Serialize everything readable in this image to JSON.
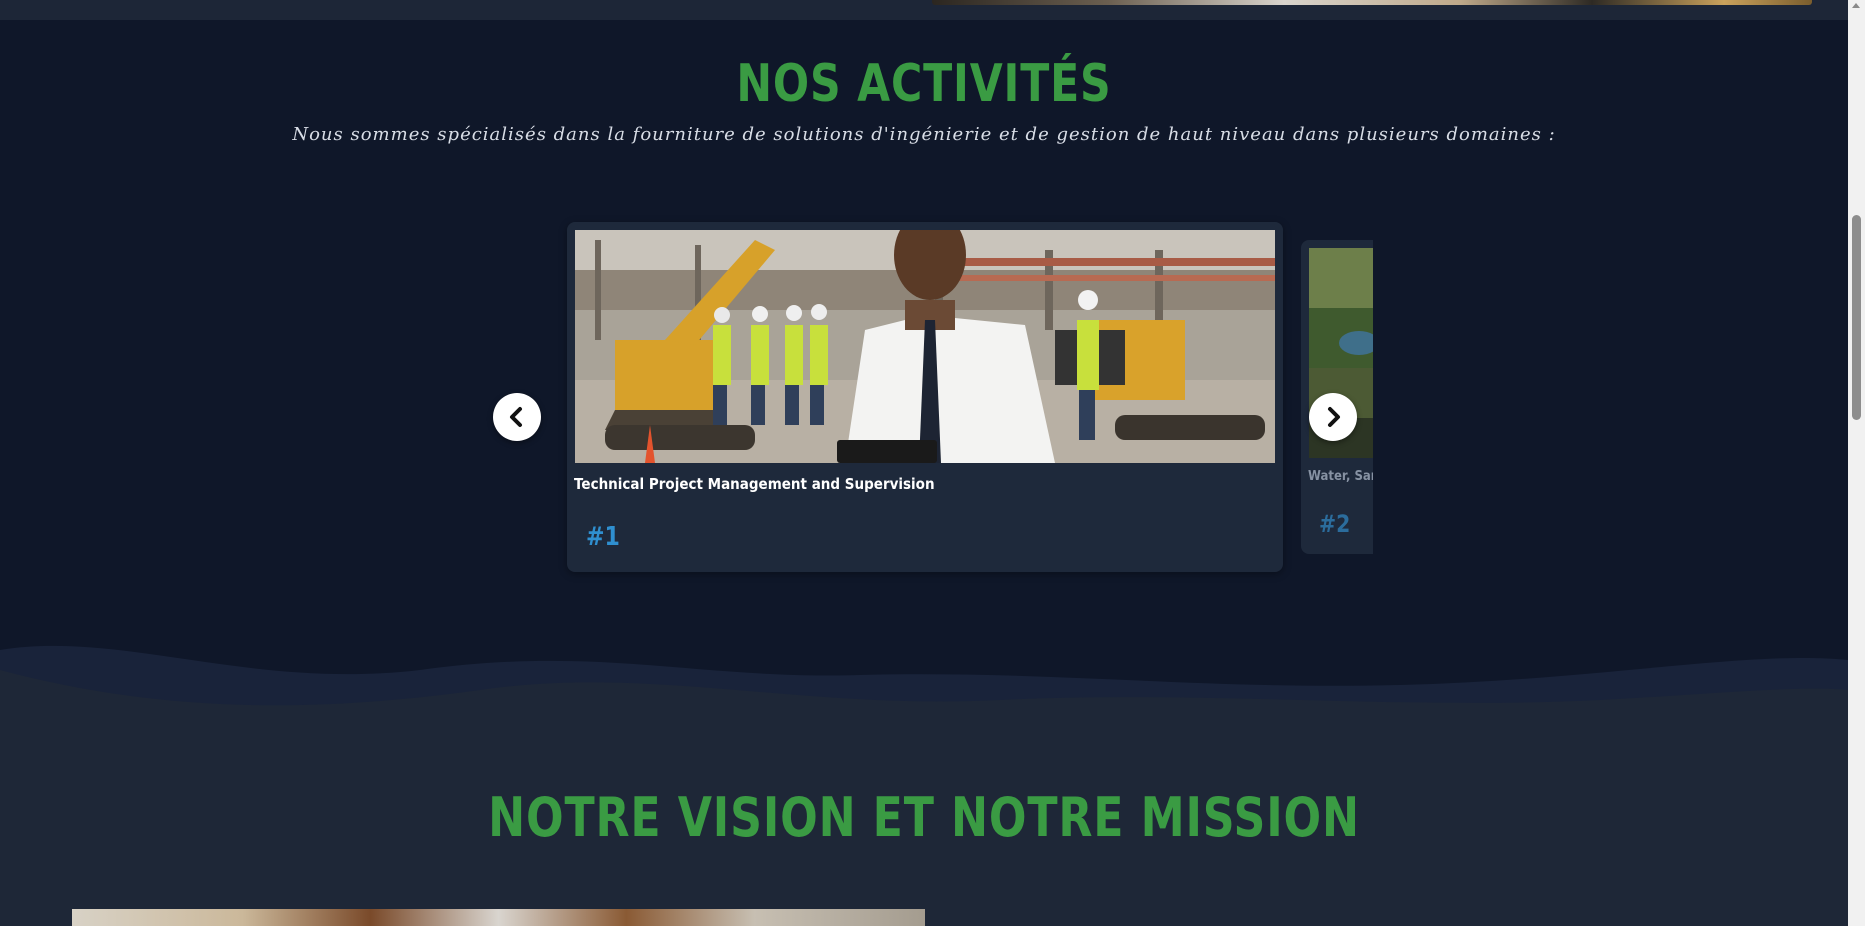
{
  "activities": {
    "title": "NOS ACTIVITÉS",
    "subtitle": "Nous sommes spécialisés dans la fourniture de solutions d'ingénierie et de gestion de haut niveau dans plusieurs domaines :",
    "carousel": {
      "prev_icon": "chevron-left-icon",
      "next_icon": "chevron-right-icon",
      "cards": [
        {
          "title": "Technical Project Management and Supervision",
          "number": "#1"
        },
        {
          "title": "Water, San",
          "number": "#2"
        }
      ]
    }
  },
  "vision": {
    "title": "NOTRE VISION ET NOTRE MISSION"
  },
  "colors": {
    "background": "#0f1729",
    "section_alt": "#1e2737",
    "card": "#1e293b",
    "heading_green": "#3a9b43",
    "number_blue": "#2f8fd0"
  }
}
